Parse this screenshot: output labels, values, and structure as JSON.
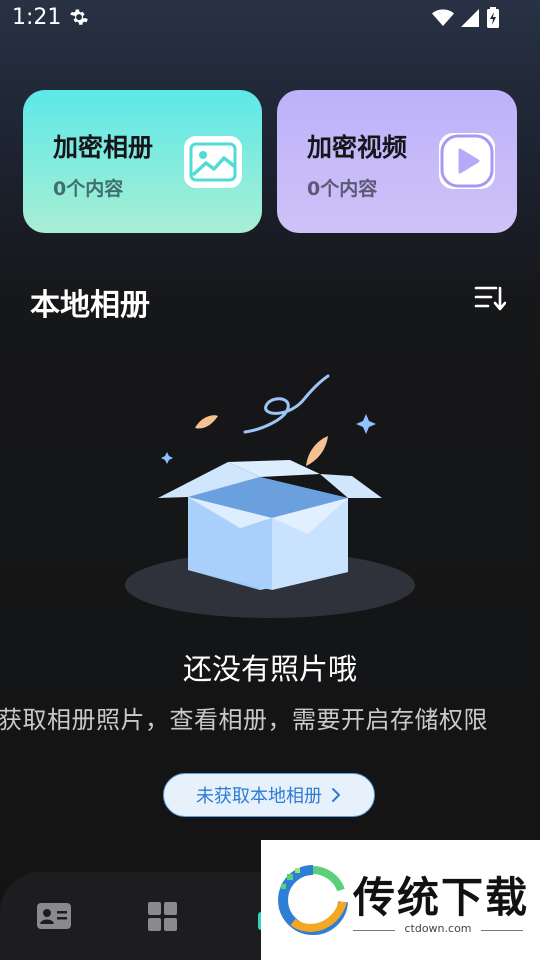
{
  "status_bar": {
    "time": "1:21",
    "icons": [
      "gear-icon",
      "wifi-icon",
      "signal-icon",
      "battery-icon"
    ]
  },
  "cards": [
    {
      "title": "加密相册",
      "count": "0个内容",
      "icon": "image-icon"
    },
    {
      "title": "加密视频",
      "count": "0个内容",
      "icon": "play-icon"
    }
  ],
  "local_album": {
    "title": "本地相册",
    "sort_icon": "sort-icon"
  },
  "empty_state": {
    "title": "还没有照片哦",
    "description": "获取相册照片，查看相册，需要开启存储权限",
    "button_label": "未获取本地相册"
  },
  "bottom_nav": {
    "items": [
      "contact-card-icon",
      "grid-icon",
      "active-tab"
    ]
  },
  "watermark": {
    "text": "传统下载",
    "url": "ctdown.com"
  },
  "colors": {
    "accent_blue": "#2e7bd3",
    "photo_card": "#5de8e8",
    "video_card": "#bdb2fb",
    "active_tab": "#2fd3c8"
  }
}
